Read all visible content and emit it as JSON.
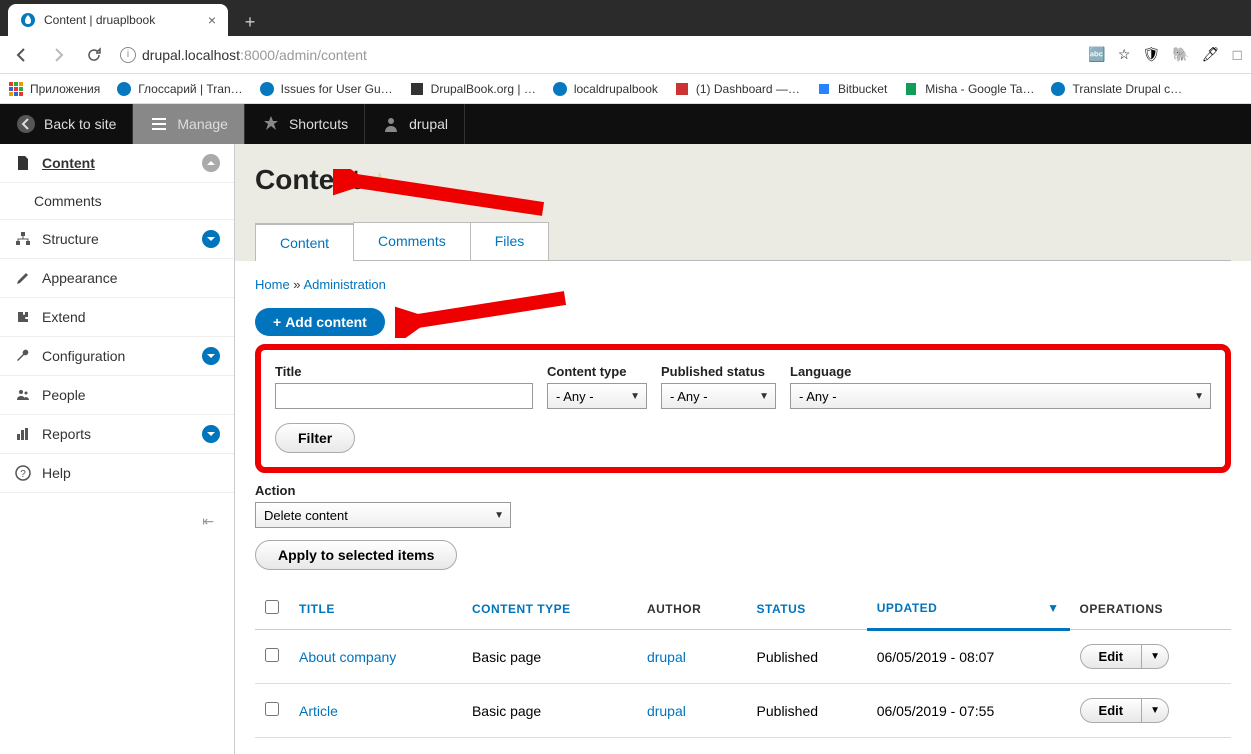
{
  "browser": {
    "tab_title": "Content | druaplbook",
    "url_host": "drupal.localhost",
    "url_port": ":8000",
    "url_path": "/admin/content"
  },
  "bookmarks": [
    {
      "label": "Приложения"
    },
    {
      "label": "Глоссарий | Tran…"
    },
    {
      "label": "Issues for User Gu…"
    },
    {
      "label": "DrupalBook.org | …"
    },
    {
      "label": "localdrupalbook"
    },
    {
      "label": "(1) Dashboard —…"
    },
    {
      "label": "Bitbucket"
    },
    {
      "label": "Misha - Google Ta…"
    },
    {
      "label": "Translate Drupal c…"
    }
  ],
  "admin_toolbar": {
    "back": "Back to site",
    "manage": "Manage",
    "shortcuts": "Shortcuts",
    "user": "drupal"
  },
  "sidebar": {
    "items": [
      {
        "label": "Content"
      },
      {
        "label": "Comments"
      },
      {
        "label": "Structure"
      },
      {
        "label": "Appearance"
      },
      {
        "label": "Extend"
      },
      {
        "label": "Configuration"
      },
      {
        "label": "People"
      },
      {
        "label": "Reports"
      },
      {
        "label": "Help"
      }
    ]
  },
  "page": {
    "title": "Content",
    "tabs": {
      "content": "Content",
      "comments": "Comments",
      "files": "Files"
    },
    "breadcrumb_home": "Home",
    "breadcrumb_sep": " » ",
    "breadcrumb_admin": "Administration",
    "add_content": "Add content",
    "filters": {
      "title_label": "Title",
      "type_label": "Content type",
      "status_label": "Published status",
      "lang_label": "Language",
      "any": "- Any -",
      "filter_btn": "Filter"
    },
    "action": {
      "label": "Action",
      "value": "Delete content",
      "apply": "Apply to selected items"
    },
    "table": {
      "headers": {
        "title": "TITLE",
        "type": "CONTENT TYPE",
        "author": "AUTHOR",
        "status": "STATUS",
        "updated": "UPDATED",
        "ops": "OPERATIONS"
      },
      "rows": [
        {
          "title": "About company",
          "type": "Basic page",
          "author": "drupal",
          "status": "Published",
          "updated": "06/05/2019 - 08:07",
          "edit": "Edit"
        },
        {
          "title": "Article",
          "type": "Basic page",
          "author": "drupal",
          "status": "Published",
          "updated": "06/05/2019 - 07:55",
          "edit": "Edit"
        }
      ]
    }
  }
}
